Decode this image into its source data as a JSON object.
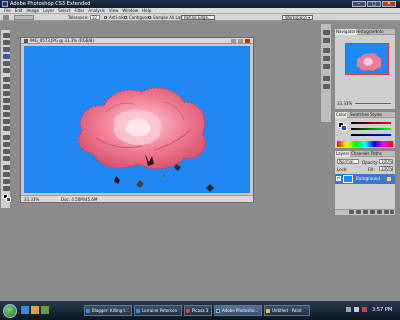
{
  "window": {
    "title": "Adobe Photoshop CS3 Extended",
    "controls": [
      "–",
      "▢",
      "✕"
    ]
  },
  "menu": [
    "File",
    "Edit",
    "Image",
    "Layer",
    "Select",
    "Filter",
    "Analysis",
    "View",
    "Window",
    "Help"
  ],
  "options_bar": {
    "tolerance_label": "Tolerance:",
    "tolerance_value": "32",
    "anti_alias": "Anti-alias",
    "contiguous": "Contiguous",
    "sample_all": "Sample All Layers",
    "refine_edge": "Refine Edge...",
    "workspace": "Workspace ▾"
  },
  "document": {
    "title": "IMG_0573.JPG @ 33.3% (RGB/8)",
    "status": "Doc: 4.50M/45.6M",
    "zoom": "33.33%",
    "canvas_color": "#2088f5"
  },
  "navigator": {
    "tabs": [
      "Navigator",
      "Histogram",
      "Info"
    ],
    "zoom": "33.33%"
  },
  "color_panel": {
    "tabs": [
      "Color",
      "Swatches",
      "Styles"
    ]
  },
  "layers": {
    "tabs": [
      "Layers",
      "Channels",
      "Paths"
    ],
    "mode": "Normal",
    "opacity_label": "Opacity:",
    "opacity": "100%",
    "lock_label": "Lock:",
    "fill_label": "Fill:",
    "fill": "100%",
    "layer_name": "Background"
  },
  "taskbar": {
    "items": [
      {
        "label": "Blogger: Killing t...",
        "icon": "ie-icon"
      },
      {
        "label": "Lorraine Peterson",
        "icon": "ie-icon"
      },
      {
        "label": "Picasa 3",
        "icon": "picasa-icon"
      },
      {
        "label": "Adobe Photosho...",
        "icon": "ps-icon"
      },
      {
        "label": "Untitled - Paint",
        "icon": "paint-icon"
      }
    ],
    "clock": "3:57 PM"
  }
}
